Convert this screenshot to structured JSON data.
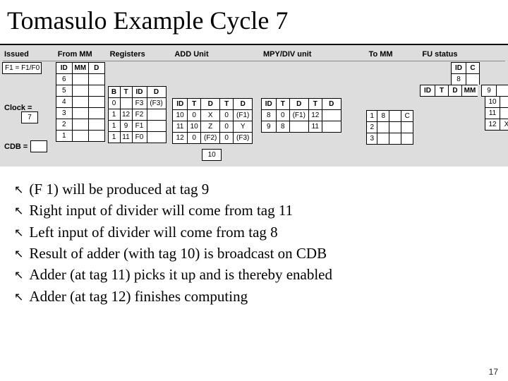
{
  "title": "Tomasulo Example Cycle 7",
  "headers": {
    "issued": "Issued",
    "from_mm": "From MM",
    "registers": "Registers",
    "add": "ADD Unit",
    "mpy": "MPY/DIV unit",
    "to_mm": "To MM",
    "fu": "FU status"
  },
  "issued": {
    "expr_label": "F1 = F1/F0",
    "clock_label": "Clock =",
    "clock_value": "7",
    "cdb_label": "CDB ="
  },
  "from_mm": {
    "header": [
      "ID",
      "MM",
      "D"
    ],
    "rows": [
      [
        "6",
        "",
        ""
      ],
      [
        "5",
        "",
        ""
      ],
      [
        "4",
        "",
        ""
      ],
      [
        "3",
        "",
        ""
      ],
      [
        "2",
        "",
        ""
      ],
      [
        "1",
        "",
        ""
      ]
    ]
  },
  "registers": {
    "header": [
      "B",
      "T",
      "ID",
      "D"
    ],
    "rows": [
      [
        "0",
        "",
        "F3",
        "(F3)"
      ],
      [
        "1",
        "12",
        "F2",
        ""
      ],
      [
        "1",
        "9",
        "F1",
        ""
      ],
      [
        "1",
        "11",
        "F0",
        ""
      ]
    ]
  },
  "add_unit": {
    "header": [
      "ID",
      "T",
      "D",
      "T",
      "D"
    ],
    "rows": [
      [
        "10",
        "0",
        "X",
        "0",
        "(F1)"
      ],
      [
        "11",
        "10",
        "Z",
        "0",
        "Y"
      ],
      [
        "12",
        "0",
        "(F2)",
        "0",
        "(F3)"
      ]
    ],
    "out": "10"
  },
  "mpy_unit": {
    "header": [
      "ID",
      "T",
      "D",
      "T",
      "D"
    ],
    "rows": [
      [
        "8",
        "0",
        "(F1)",
        "12",
        ""
      ],
      [
        "9",
        "8",
        "",
        "11",
        ""
      ]
    ]
  },
  "to_mm": {
    "rows": [
      [
        "1",
        "8",
        "",
        "C"
      ],
      [
        "2",
        "",
        "",
        ""
      ],
      [
        "3",
        "",
        "",
        ""
      ]
    ]
  },
  "fu": {
    "header": [
      "ID",
      "C"
    ],
    "rows": [
      [
        "8",
        ""
      ],
      [
        "9",
        ""
      ],
      [
        "10",
        ""
      ],
      [
        "11",
        ""
      ],
      [
        "12",
        "X"
      ]
    ],
    "mid_header": [
      "ID",
      "T",
      "D",
      "MM"
    ]
  },
  "bullets": [
    "(F 1) will be produced at tag 9",
    "Right input of divider will come from tag 11",
    "Left input of divider will come from tag 8",
    "Result of adder (with tag 10) is broadcast on CDB",
    "Adder (at tag 11) picks it up and is thereby enabled",
    "Adder (at tag 12) finishes computing"
  ],
  "page_number": "17"
}
